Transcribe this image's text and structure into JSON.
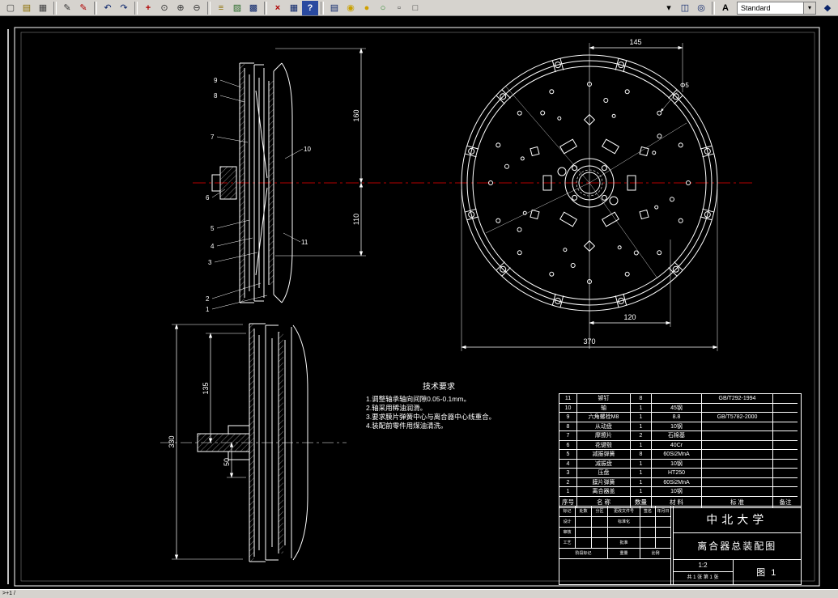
{
  "colors": {
    "centerline_red": "#b40000",
    "line_white": "#ffffff",
    "toolbar_bg": "#d6d3ce"
  },
  "toolbar": {
    "combo_arrow": "▾",
    "style_combo": {
      "value": "Standard"
    },
    "icons": [
      {
        "name": "new-file",
        "glyph": "▢",
        "style": "color:#404040"
      },
      {
        "name": "open-file",
        "glyph": "▤",
        "style": "color:#8a6d00"
      },
      {
        "name": "print",
        "glyph": "▦",
        "style": "color:#404040"
      },
      {
        "name": "pencil",
        "glyph": "✎",
        "style": "color:#333333"
      },
      {
        "name": "pen-red",
        "glyph": "✎",
        "style": "color:#b00000"
      },
      {
        "name": "undo",
        "glyph": "↶",
        "style": "color:#0a246a"
      },
      {
        "name": "redo",
        "glyph": "↷",
        "style": "color:#0a246a"
      },
      {
        "name": "pan",
        "glyph": "+",
        "style": "color:#b00000;font-weight:bold"
      },
      {
        "name": "zoom-realtime",
        "glyph": "⊙",
        "style": "color:#333333"
      },
      {
        "name": "zoom-in",
        "glyph": "⊕",
        "style": "color:#333333"
      },
      {
        "name": "zoom-out",
        "glyph": "⊖",
        "style": "color:#333333"
      },
      {
        "name": "layer-properties",
        "glyph": "≡",
        "style": "color:#8a6d00"
      },
      {
        "name": "object-properties",
        "glyph": "▨",
        "style": "color:#2a6a2a"
      },
      {
        "name": "design-center",
        "glyph": "▩",
        "style": "color:#0a246a"
      },
      {
        "name": "erase",
        "glyph": "×",
        "style": "color:#b00000;font-weight:bold"
      },
      {
        "name": "table",
        "glyph": "▦",
        "style": "color:#0a246a"
      },
      {
        "name": "help",
        "glyph": "?",
        "style": "color:#ffffff;background:#2a4aa0;font-weight:bold"
      },
      {
        "name": "views",
        "glyph": "▤",
        "style": "color:#0a246a"
      },
      {
        "name": "render",
        "glyph": "◉",
        "style": "color:#c8a000"
      },
      {
        "name": "lights",
        "glyph": "●",
        "style": "color:#d0a000"
      },
      {
        "name": "materials",
        "glyph": "○",
        "style": "color:#2a8a2a"
      },
      {
        "name": "background",
        "glyph": "▫",
        "style": "color:#404040"
      },
      {
        "name": "box",
        "glyph": "□",
        "style": "color:#404040"
      },
      {
        "name": "overflow",
        "glyph": "▾",
        "style": "color:#000000"
      },
      {
        "name": "named-views",
        "glyph": "◫",
        "style": "color:#0a246a"
      },
      {
        "name": "orbit",
        "glyph": "◎",
        "style": "color:#0a246a"
      },
      {
        "name": "text-style",
        "glyph": "A",
        "style": "color:#000000;font-weight:bold"
      },
      {
        "name": "dim-style",
        "glyph": "◆",
        "style": "color:#0a246a"
      }
    ]
  },
  "statusbar": {
    "text": ">+1 /"
  },
  "drawing": {
    "dims": {
      "d145": "145",
      "dphi5": "Φ5",
      "d120": "120",
      "d370": "370",
      "d160": "160",
      "d110": "110",
      "d330": "330",
      "d135": "135",
      "d50": "50"
    },
    "part_labels": {
      "p1": "1",
      "p2": "2",
      "p3": "3",
      "p4": "4",
      "p5": "5",
      "p6": "6",
      "p7": "7",
      "p8": "8",
      "p9": "9",
      "p10": "10",
      "p11": "11"
    },
    "tech_req": {
      "title": "技术要求",
      "lines": [
        "1.调整轴承轴向间隙0.05-0.1mm。",
        "2.轴采用稀油润滑。",
        "3.要求膜片弹簧中心与离合器中心线重合。",
        "4.装配前零件用煤油清洗。"
      ]
    },
    "bom": {
      "header": [
        "序号",
        "名  称",
        "数量",
        "材  料",
        "标  准",
        "备注"
      ],
      "rows": [
        {
          "no": "11",
          "name": "铆钉",
          "qty": "8",
          "mat": "",
          "std": "GB/T292-1994",
          "note": ""
        },
        {
          "no": "10",
          "name": "轴",
          "qty": "1",
          "mat": "45钢",
          "std": "",
          "note": ""
        },
        {
          "no": "9",
          "name": "六角螺栓M8",
          "qty": "1",
          "mat": "8.8",
          "std": "GB/T5782-2000",
          "note": ""
        },
        {
          "no": "8",
          "name": "从动盘",
          "qty": "1",
          "mat": "10钢",
          "std": "",
          "note": ""
        },
        {
          "no": "7",
          "name": "摩擦片",
          "qty": "2",
          "mat": "石棉基",
          "std": "",
          "note": ""
        },
        {
          "no": "6",
          "name": "花键毂",
          "qty": "1",
          "mat": "40Cr",
          "std": "",
          "note": ""
        },
        {
          "no": "5",
          "name": "减振弹簧",
          "qty": "8",
          "mat": "60Si2MnA",
          "std": "",
          "note": ""
        },
        {
          "no": "4",
          "name": "减振盘",
          "qty": "1",
          "mat": "10钢",
          "std": "",
          "note": ""
        },
        {
          "no": "3",
          "name": "压盘",
          "qty": "1",
          "mat": "HT250",
          "std": "",
          "note": ""
        },
        {
          "no": "2",
          "name": "膜片弹簧",
          "qty": "1",
          "mat": "60Si2MnA",
          "std": "",
          "note": ""
        },
        {
          "no": "1",
          "name": "离合器盖",
          "qty": "1",
          "mat": "10钢",
          "std": "",
          "note": ""
        }
      ]
    },
    "title_block": {
      "university": "中北大学",
      "drawing_title": "离合器总装配图",
      "figure": "图 1",
      "scale": "1:2",
      "sheets": "共 1 张  第 1 张",
      "labels": {
        "mark": "标记",
        "count": "处数",
        "zone": "分区",
        "change_no": "更改文件号",
        "sign": "签名",
        "date": "年月日",
        "design": "设计",
        "standardize": "标准化",
        "check": "审核",
        "process": "工艺",
        "approve": "批准",
        "stage": "阶段标记",
        "weight": "重量",
        "ratio": "比例"
      }
    }
  }
}
